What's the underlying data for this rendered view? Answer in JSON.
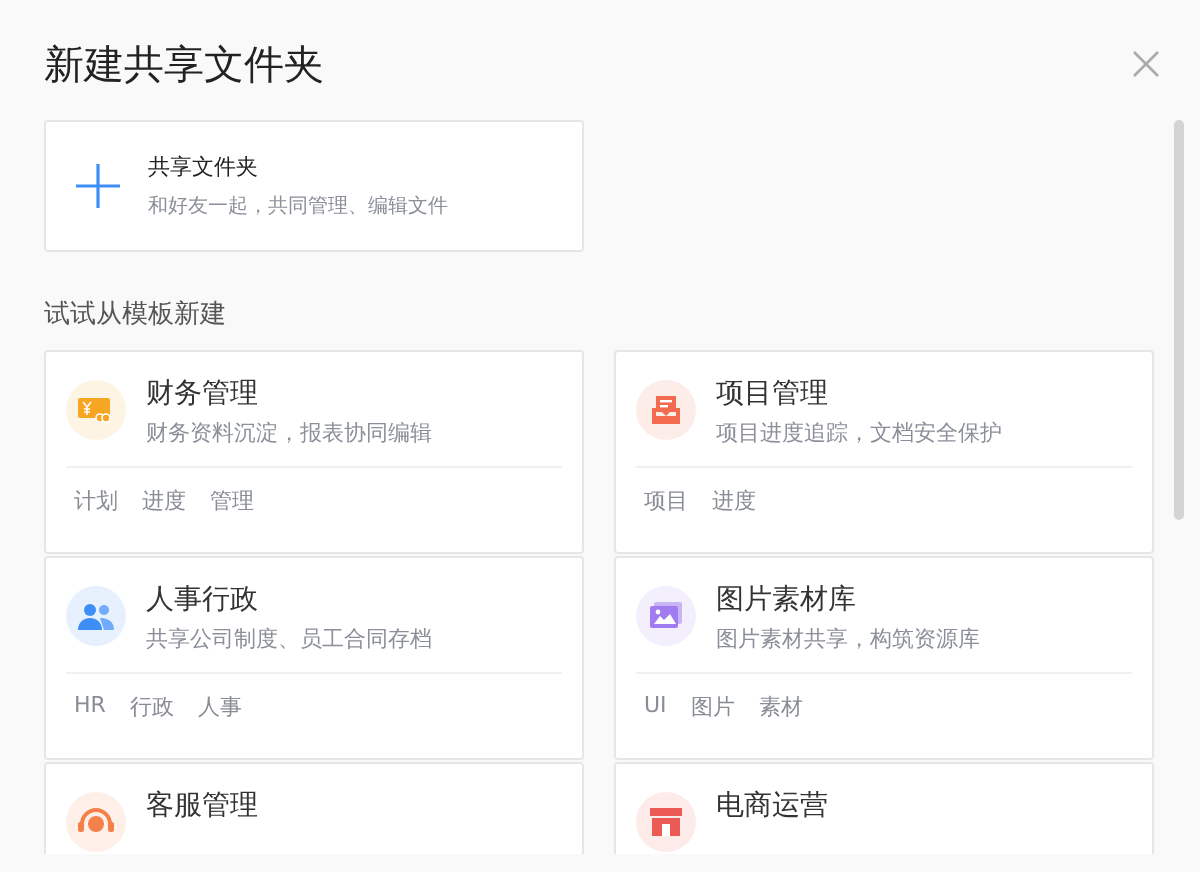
{
  "dialog": {
    "title": "新建共享文件夹"
  },
  "shared_folder": {
    "title": "共享文件夹",
    "description": "和好友一起，共同管理、编辑文件"
  },
  "templates_heading": "试试从模板新建",
  "templates": [
    {
      "kind": "money",
      "color": "#f7a623",
      "title": "财务管理",
      "description": "财务资料沉淀，报表协同编辑",
      "tags": [
        "计划",
        "进度",
        "管理"
      ]
    },
    {
      "kind": "inbox",
      "color": "#f26b4e",
      "title": "项目管理",
      "description": "项目进度追踪，文档安全保护",
      "tags": [
        "项目",
        "进度"
      ]
    },
    {
      "kind": "people",
      "color": "#3d8ef7",
      "title": "人事行政",
      "description": "共享公司制度、员工合同存档",
      "tags": [
        "HR",
        "行政",
        "人事"
      ]
    },
    {
      "kind": "image",
      "color": "#a07cf0",
      "title": "图片素材库",
      "description": "图片素材共享，构筑资源库",
      "tags": [
        "UI",
        "图片",
        "素材"
      ]
    },
    {
      "kind": "headset",
      "color": "#f5814a",
      "title": "客服管理"
    },
    {
      "kind": "shop",
      "color": "#ec5a55",
      "title": "电商运营"
    }
  ]
}
